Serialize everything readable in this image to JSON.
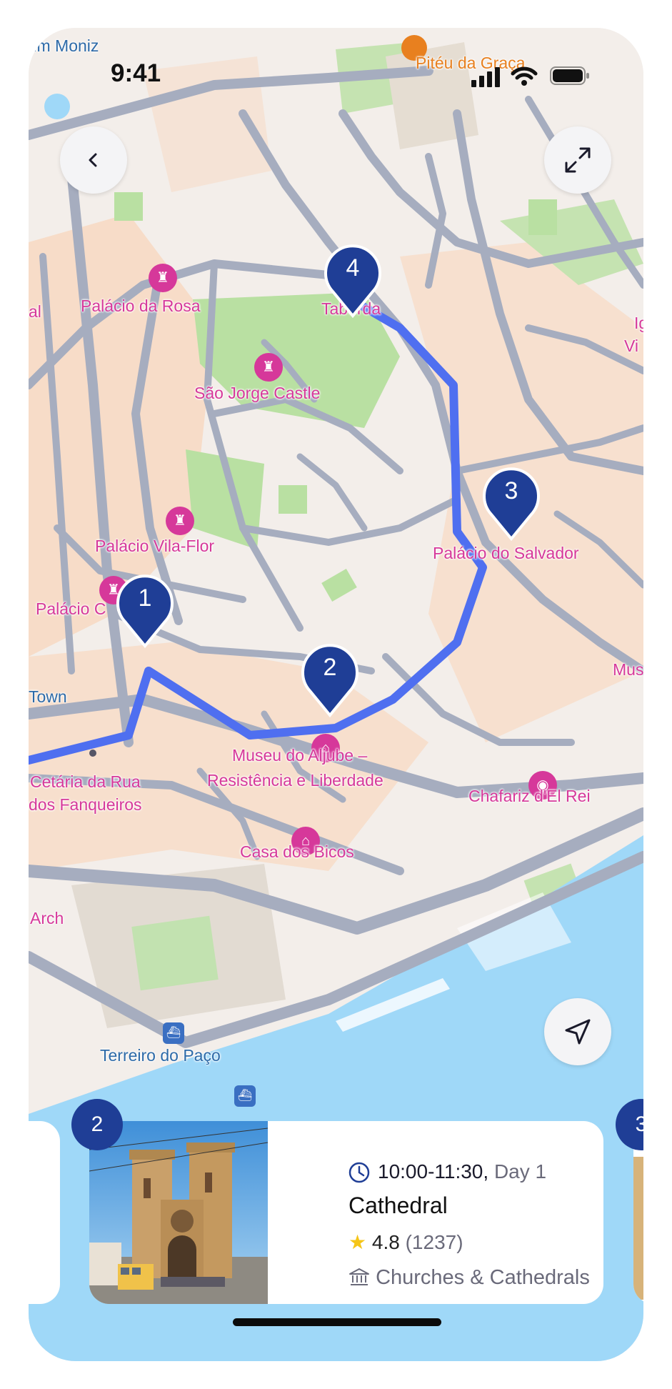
{
  "status_bar": {
    "time": "9:41"
  },
  "map": {
    "labels": {
      "timoniz": "tim Moniz",
      "piteu": "Pitéu da Graça",
      "al": "al",
      "palacio_rosa": "Palácio da Rosa",
      "taborda": "Taborda",
      "ig": "Ig",
      "vi": "Vi",
      "sao_jorge": "São Jorge Castle",
      "palacio_vila_flor": "Palácio Vila-Flor",
      "palacio_salvador": "Palácio do Salvador",
      "palacio_c": "Palácio C",
      "mus": "Mus",
      "town": "Town",
      "museu_aljube_1": "Museu do Aljube –",
      "museu_aljube_2": "Resistência e Liberdade",
      "cetaria_1": "Cetária da Rua",
      "cetaria_2": "dos Fanqueiros",
      "chafariz": "Chafariz d'El Rei",
      "casa_bicos": "Casa dos Bicos",
      "arch": "Arch",
      "terreiro": "Terreiro do Paço"
    },
    "route_color": "#4f6ff0",
    "markers": [
      "1",
      "2",
      "3",
      "4"
    ],
    "icons": [
      "back-icon",
      "expand-icon",
      "navigate-icon",
      "castle-icon",
      "camera-icon",
      "museum-icon",
      "ferry-icon",
      "restaurant-icon"
    ]
  },
  "cards": {
    "current": {
      "number": "2",
      "time": "10:00-11:30,",
      "day": "Day 1",
      "title": "Cathedral",
      "rating": "4.8",
      "reviews": "(1237)",
      "category": "Churches & Cathedrals"
    },
    "next_number": "3"
  },
  "colors": {
    "accent": "#1f3e96",
    "route": "#4f6ff0",
    "poi": "#d6389a",
    "water": "#9fd8f8",
    "star": "#f5c518"
  }
}
